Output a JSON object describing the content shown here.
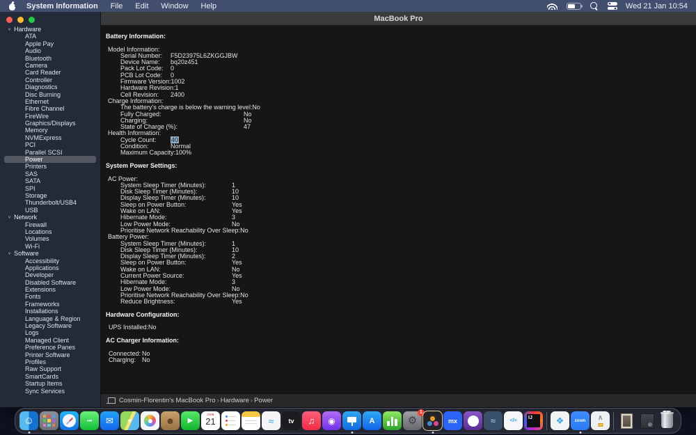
{
  "menu_bar": {
    "apple_icon": "apple-logo",
    "app_name": "System Information",
    "menus": [
      "File",
      "Edit",
      "Window",
      "Help"
    ],
    "status_icons": [
      "wifi-icon",
      "battery-icon",
      "search-icon",
      "control-center-icon"
    ],
    "clock": "Wed 21 Jan 10:54"
  },
  "window": {
    "title": "MacBook Pro",
    "traffic_lights": {
      "close": "#ff5f57",
      "minimize": "#febc2e",
      "zoom": "#28c840"
    },
    "sidebar": {
      "groups": [
        {
          "label": "Hardware",
          "selected": "Power",
          "items": [
            "ATA",
            "Apple Pay",
            "Audio",
            "Bluetooth",
            "Camera",
            "Card Reader",
            "Controller",
            "Diagnostics",
            "Disc Burning",
            "Ethernet",
            "Fibre Channel",
            "FireWire",
            "Graphics/Displays",
            "Memory",
            "NVMExpress",
            "PCI",
            "Parallel SCSI",
            "Power",
            "Printers",
            "SAS",
            "SATA",
            "SPI",
            "Storage",
            "Thunderbolt/USB4",
            "USB"
          ]
        },
        {
          "label": "Network",
          "selected": null,
          "items": [
            "Firewall",
            "Locations",
            "Volumes",
            "Wi-Fi"
          ]
        },
        {
          "label": "Software",
          "selected": null,
          "items": [
            "Accessibility",
            "Applications",
            "Developer",
            "Disabled Software",
            "Extensions",
            "Fonts",
            "Frameworks",
            "Installations",
            "Language & Region",
            "Legacy Software",
            "Logs",
            "Managed Client",
            "Preference Panes",
            "Printer Software",
            "Profiles",
            "Raw Support",
            "SmartCards",
            "Startup Items",
            "Sync Services"
          ]
        }
      ]
    },
    "content": {
      "selection_color": "#8fafca",
      "sections": [
        {
          "title": "Battery Information:",
          "groups": [
            {
              "label": "Model Information:",
              "label_width": 72,
              "rows": [
                {
                  "label": "Serial Number:",
                  "value": "F5D23975L6ZKGGJBW"
                },
                {
                  "label": "Device Name:",
                  "value": "bq20z451"
                },
                {
                  "label": "Pack Lot Code:",
                  "value": "0"
                },
                {
                  "label": "PCB Lot Code:",
                  "value": "0"
                },
                {
                  "label": "Firmware Version:",
                  "value": "1002"
                },
                {
                  "label": "Hardware Revision:",
                  "value": "1"
                },
                {
                  "label": "Cell Revision:",
                  "value": "2400"
                }
              ]
            },
            {
              "label": "Charge Information:",
              "label_width": 177,
              "rows": [
                {
                  "label": "The battery's charge is below the warning level:",
                  "value": "No"
                },
                {
                  "label": "Fully Charged:",
                  "value": "No"
                },
                {
                  "label": "Charging:",
                  "value": "No"
                },
                {
                  "label": "State of Charge (%):",
                  "value": "47"
                }
              ]
            },
            {
              "label": "Health Information:",
              "label_width": 72,
              "rows": [
                {
                  "label": "Cycle Count:",
                  "value": "40",
                  "selected": true
                },
                {
                  "label": "Condition:",
                  "value": "Normal"
                },
                {
                  "label": "Maximum Capacity:",
                  "value": "100%"
                }
              ]
            }
          ]
        },
        {
          "title": "System Power Settings:",
          "groups": [
            {
              "label": "AC Power:",
              "label_width": 160,
              "rows": [
                {
                  "label": "System Sleep Timer (Minutes):",
                  "value": "1"
                },
                {
                  "label": "Disk Sleep Timer (Minutes):",
                  "value": "10"
                },
                {
                  "label": "Display Sleep Timer (Minutes):",
                  "value": "10"
                },
                {
                  "label": "Sleep on Power Button:",
                  "value": "Yes"
                },
                {
                  "label": "Wake on LAN:",
                  "value": "Yes"
                },
                {
                  "label": "Hibernate Mode:",
                  "value": "3"
                },
                {
                  "label": "Low Power Mode:",
                  "value": "No"
                },
                {
                  "label": "Prioritise Network Reachability Over Sleep:",
                  "value": "No"
                }
              ]
            },
            {
              "label": "Battery Power:",
              "label_width": 160,
              "rows": [
                {
                  "label": "System Sleep Timer (Minutes):",
                  "value": "1"
                },
                {
                  "label": "Disk Sleep Timer (Minutes):",
                  "value": "10"
                },
                {
                  "label": "Display Sleep Timer (Minutes):",
                  "value": "2"
                },
                {
                  "label": "Sleep on Power Button:",
                  "value": "Yes"
                },
                {
                  "label": "Wake on LAN:",
                  "value": "No"
                },
                {
                  "label": "Current Power Source:",
                  "value": "Yes"
                },
                {
                  "label": "Hibernate Mode:",
                  "value": "3"
                },
                {
                  "label": "Low Power Mode:",
                  "value": "No"
                },
                {
                  "label": "Prioritise Network Reachability Over Sleep:",
                  "value": "No"
                },
                {
                  "label": "Reduce Brightness:",
                  "value": "Yes"
                }
              ]
            }
          ]
        },
        {
          "title": "Hardware Configuration:",
          "groups": [
            {
              "label": null,
              "inline": true,
              "label_width": 56,
              "rows": [
                {
                  "label": "UPS Installed:",
                  "value": "No"
                }
              ]
            }
          ]
        },
        {
          "title": "AC Charger Information:",
          "groups": [
            {
              "label": null,
              "inline": true,
              "label_width": 48,
              "rows": [
                {
                  "label": "Connected:",
                  "value": "No"
                },
                {
                  "label": "Charging:",
                  "value": "No"
                }
              ]
            }
          ]
        }
      ]
    },
    "status_bar": {
      "device_icon": "macbook-icon",
      "path": [
        "Cosmin-Florentin's MacBook Pro",
        "Hardware",
        "Power"
      ],
      "separator": "›"
    }
  },
  "dock": {
    "icons": [
      {
        "name": "finder",
        "kind": "finder",
        "glyph": "☺",
        "running": true
      },
      {
        "name": "launchpad",
        "kind": "launchpad",
        "bg": "linear-gradient(180deg,#8b9098,#6d7178)"
      },
      {
        "name": "safari",
        "kind": "safari",
        "bg": "linear-gradient(180deg,#22b5f5,#1273e8)"
      },
      {
        "name": "messages",
        "glyph": "•••",
        "bg": "linear-gradient(180deg,#6bf27d,#10bd34)",
        "fg": "#ffffff",
        "glyph_size": 8
      },
      {
        "name": "mail",
        "glyph": "✉",
        "bg": "linear-gradient(180deg,#22a1f5,#0f66ee)",
        "fg": "#ffffff",
        "glyph_size": 13
      },
      {
        "name": "maps",
        "kind": "maps",
        "glyph": "➤",
        "bg": "linear-gradient(115deg,#94d95d 0 45%,#f8e471 45% 58%,#58b8f2 58%)",
        "fg": "#ffffff",
        "glyph_size": 9
      },
      {
        "name": "photos",
        "kind": "photos",
        "bg": "#f4f5f7"
      },
      {
        "name": "contacts",
        "glyph": "☻",
        "bg": "linear-gradient(180deg,#caa06a,#9a7342)",
        "fg": "#574027",
        "glyph_size": 13
      },
      {
        "name": "facetime",
        "glyph": "▶",
        "bg": "linear-gradient(180deg,#55e867,#11b52e)",
        "fg": "#ffffff",
        "glyph_size": 10
      },
      {
        "name": "calendar",
        "kind": "calendar",
        "month": "JAN",
        "day": "21",
        "bg": "#ffffff"
      },
      {
        "name": "reminders",
        "kind": "reminders",
        "bg": "#ffffff",
        "dot_colors": [
          "#3b82f7",
          "#fa3b30",
          "#ff9500"
        ]
      },
      {
        "name": "notes",
        "kind": "notes"
      },
      {
        "name": "freeform",
        "glyph": "≈",
        "bg": "#f4f5f7",
        "fg": "#2f9de8",
        "glyph_size": 14
      },
      {
        "name": "apple-tv",
        "text": "tv",
        "bg": "#1c1c1e",
        "fg": "#ffffff",
        "text_size": 9
      },
      {
        "name": "music",
        "glyph": "♫",
        "bg": "linear-gradient(180deg,#fd5e7a,#f22c44)",
        "fg": "#ffffff",
        "glyph_size": 13
      },
      {
        "name": "podcasts",
        "glyph": "◉",
        "bg": "linear-gradient(180deg,#b06cf5,#7230ec)",
        "fg": "#ffffff",
        "glyph_size": 12
      },
      {
        "name": "keynote",
        "kind": "keynote",
        "bg": "linear-gradient(180deg,#2fa7f2,#1369e0)",
        "running": true
      },
      {
        "name": "app-store",
        "text": "A",
        "bg": "linear-gradient(180deg,#2fa7f5,#1165e8)",
        "fg": "#ffffff",
        "text_size": 11
      },
      {
        "name": "numbers",
        "kind": "numbers",
        "bg": "linear-gradient(180deg,#8fe960,#2aa32c)"
      },
      {
        "name": "system-settings",
        "glyph": "⚙",
        "bg": "linear-gradient(180deg,#9fa0a6,#66676d)",
        "fg": "#3e3f44",
        "glyph_size": 15,
        "badge": "1"
      },
      {
        "name": "davinci-resolve",
        "kind": "resolve",
        "bg": "#242428",
        "ring": true,
        "running": true
      },
      {
        "name": "mx",
        "text": "mx",
        "bg": "#2a63f5",
        "fg": "#ffffff",
        "text_size": 9
      },
      {
        "name": "github",
        "kind": "github",
        "bg": "linear-gradient(180deg,#8a57c9,#5a2d94)"
      },
      {
        "name": "mysql-workbench",
        "glyph": "≈",
        "bg": "#39506b",
        "fg": "#aedcf5",
        "glyph_size": 13
      },
      {
        "name": "vscode",
        "text": "</>",
        "bg": "#f5f6f8",
        "fg": "#1f9cf0",
        "text_size": 7
      },
      {
        "name": "intellij-idea",
        "kind": "intellij",
        "text": "IJ"
      },
      {
        "kind": "sep"
      },
      {
        "name": "passwords",
        "glyph": "❖",
        "bg": "#f2f3f5",
        "fg": "#35a6e8",
        "glyph_size": 13
      },
      {
        "name": "zoom",
        "text": "zoom",
        "bg": "linear-gradient(180deg,#3f8cfd,#2a7bf5)",
        "fg": "#ffffff",
        "text_size": 6,
        "running": true
      },
      {
        "name": "archive-utility",
        "kind": "archive",
        "bg": "#eef0f2"
      },
      {
        "kind": "sep"
      },
      {
        "name": "screenshot-file",
        "kind": "file"
      },
      {
        "name": "downloads-stack",
        "kind": "filedark"
      },
      {
        "name": "trash",
        "kind": "trash"
      }
    ]
  }
}
